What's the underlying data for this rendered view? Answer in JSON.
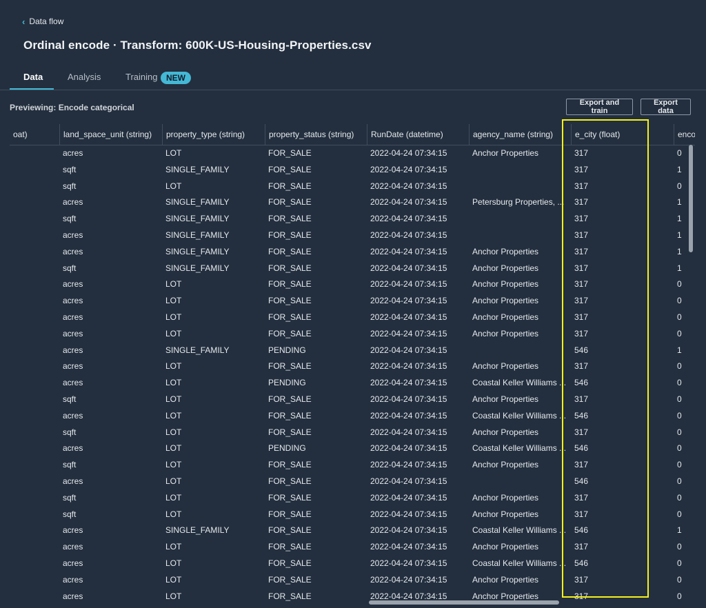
{
  "nav": {
    "back_label": "Data flow"
  },
  "page": {
    "title": "Ordinal encode · Transform: 600K-US-Housing-Properties.csv"
  },
  "tabs": [
    {
      "label": "Data"
    },
    {
      "label": "Analysis"
    },
    {
      "label": "Training",
      "badge": "NEW"
    }
  ],
  "toolbar": {
    "preview_label": "Previewing: Encode categorical",
    "export_train_label": "Export and train",
    "export_data_label": "Export data"
  },
  "colors": {
    "accent": "#44b9d6",
    "highlight": "#f7f21b",
    "background": "#232f3e"
  },
  "table": {
    "columns": [
      "oat)",
      "land_space_unit (string)",
      "property_type (string)",
      "property_status (string)",
      "RunDate (datetime)",
      "agency_name (string)",
      "e_city (float)",
      "enco"
    ],
    "rows": [
      [
        "",
        "acres",
        "LOT",
        "FOR_SALE",
        "2022-04-24 07:34:15",
        "Anchor Properties",
        "317",
        "0"
      ],
      [
        "",
        "sqft",
        "SINGLE_FAMILY",
        "FOR_SALE",
        "2022-04-24 07:34:15",
        "",
        "317",
        "1"
      ],
      [
        "",
        "sqft",
        "LOT",
        "FOR_SALE",
        "2022-04-24 07:34:15",
        "",
        "317",
        "0"
      ],
      [
        "",
        "acres",
        "SINGLE_FAMILY",
        "FOR_SALE",
        "2022-04-24 07:34:15",
        "Petersburg Properties, ...",
        "317",
        "1"
      ],
      [
        "",
        "sqft",
        "SINGLE_FAMILY",
        "FOR_SALE",
        "2022-04-24 07:34:15",
        "",
        "317",
        "1"
      ],
      [
        "",
        "acres",
        "SINGLE_FAMILY",
        "FOR_SALE",
        "2022-04-24 07:34:15",
        "",
        "317",
        "1"
      ],
      [
        "",
        "acres",
        "SINGLE_FAMILY",
        "FOR_SALE",
        "2022-04-24 07:34:15",
        "Anchor Properties",
        "317",
        "1"
      ],
      [
        "",
        "sqft",
        "SINGLE_FAMILY",
        "FOR_SALE",
        "2022-04-24 07:34:15",
        "Anchor Properties",
        "317",
        "1"
      ],
      [
        "",
        "acres",
        "LOT",
        "FOR_SALE",
        "2022-04-24 07:34:15",
        "Anchor Properties",
        "317",
        "0"
      ],
      [
        "",
        "acres",
        "LOT",
        "FOR_SALE",
        "2022-04-24 07:34:15",
        "Anchor Properties",
        "317",
        "0"
      ],
      [
        "",
        "acres",
        "LOT",
        "FOR_SALE",
        "2022-04-24 07:34:15",
        "Anchor Properties",
        "317",
        "0"
      ],
      [
        "",
        "acres",
        "LOT",
        "FOR_SALE",
        "2022-04-24 07:34:15",
        "Anchor Properties",
        "317",
        "0"
      ],
      [
        "",
        "acres",
        "SINGLE_FAMILY",
        "PENDING",
        "2022-04-24 07:34:15",
        "",
        "546",
        "1"
      ],
      [
        "",
        "acres",
        "LOT",
        "FOR_SALE",
        "2022-04-24 07:34:15",
        "Anchor Properties",
        "317",
        "0"
      ],
      [
        "",
        "acres",
        "LOT",
        "PENDING",
        "2022-04-24 07:34:15",
        "Coastal Keller Williams ...",
        "546",
        "0"
      ],
      [
        "",
        "sqft",
        "LOT",
        "FOR_SALE",
        "2022-04-24 07:34:15",
        "Anchor Properties",
        "317",
        "0"
      ],
      [
        "",
        "acres",
        "LOT",
        "FOR_SALE",
        "2022-04-24 07:34:15",
        "Coastal Keller Williams ...",
        "546",
        "0"
      ],
      [
        "",
        "sqft",
        "LOT",
        "FOR_SALE",
        "2022-04-24 07:34:15",
        "Anchor Properties",
        "317",
        "0"
      ],
      [
        "",
        "acres",
        "LOT",
        "PENDING",
        "2022-04-24 07:34:15",
        "Coastal Keller Williams ...",
        "546",
        "0"
      ],
      [
        "",
        "sqft",
        "LOT",
        "FOR_SALE",
        "2022-04-24 07:34:15",
        "Anchor Properties",
        "317",
        "0"
      ],
      [
        "",
        "acres",
        "LOT",
        "FOR_SALE",
        "2022-04-24 07:34:15",
        "",
        "546",
        "0"
      ],
      [
        "",
        "sqft",
        "LOT",
        "FOR_SALE",
        "2022-04-24 07:34:15",
        "Anchor Properties",
        "317",
        "0"
      ],
      [
        "",
        "sqft",
        "LOT",
        "FOR_SALE",
        "2022-04-24 07:34:15",
        "Anchor Properties",
        "317",
        "0"
      ],
      [
        "",
        "acres",
        "SINGLE_FAMILY",
        "FOR_SALE",
        "2022-04-24 07:34:15",
        "Coastal Keller Williams ...",
        "546",
        "1"
      ],
      [
        "",
        "acres",
        "LOT",
        "FOR_SALE",
        "2022-04-24 07:34:15",
        "Anchor Properties",
        "317",
        "0"
      ],
      [
        "",
        "acres",
        "LOT",
        "FOR_SALE",
        "2022-04-24 07:34:15",
        "Coastal Keller Williams ...",
        "546",
        "0"
      ],
      [
        "",
        "acres",
        "LOT",
        "FOR_SALE",
        "2022-04-24 07:34:15",
        "Anchor Properties",
        "317",
        "0"
      ],
      [
        "",
        "acres",
        "LOT",
        "FOR_SALE",
        "2022-04-24 07:34:15",
        "Anchor Properties",
        "317",
        "0"
      ]
    ]
  }
}
